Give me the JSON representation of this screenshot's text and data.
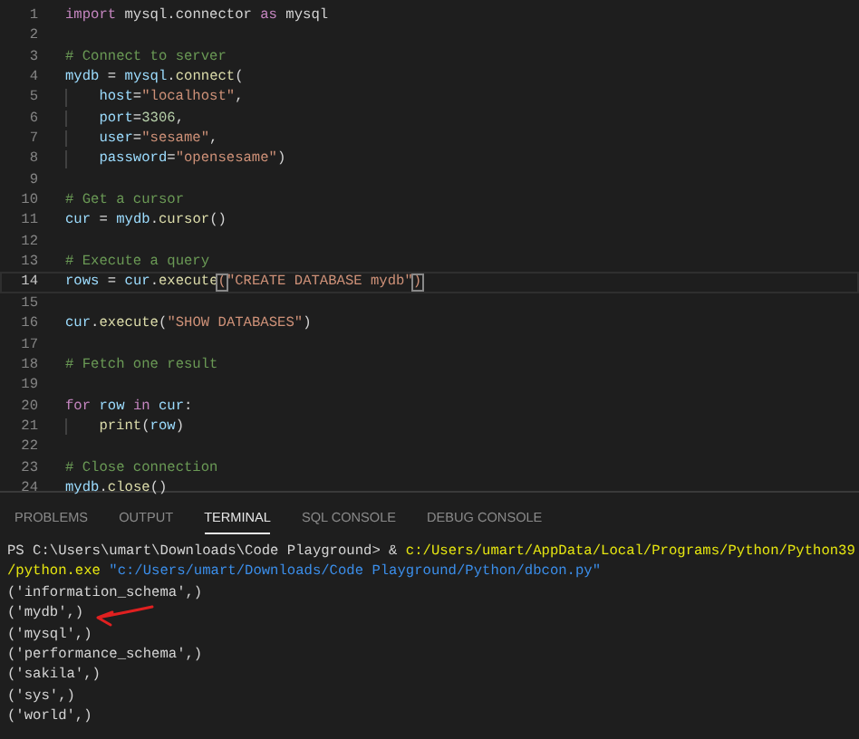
{
  "editor": {
    "lines": [
      {
        "number": "1",
        "current": false,
        "tokens": [
          {
            "kind": "keyword",
            "text": "import"
          },
          {
            "kind": "plain",
            "text": " mysql.connector "
          },
          {
            "kind": "keyword",
            "text": "as"
          },
          {
            "kind": "plain",
            "text": " mysql"
          }
        ]
      },
      {
        "number": "2",
        "current": false
      },
      {
        "number": "3",
        "current": false,
        "tokens": [
          {
            "kind": "comment",
            "text": "# Connect to server"
          }
        ]
      },
      {
        "number": "4",
        "current": false,
        "tokens": [
          {
            "kind": "var",
            "text": "mydb"
          },
          {
            "kind": "plain",
            "text": " = "
          },
          {
            "kind": "var",
            "text": "mysql"
          },
          {
            "kind": "plain",
            "text": "."
          },
          {
            "kind": "func",
            "text": "connect"
          },
          {
            "kind": "plain",
            "text": "("
          }
        ]
      },
      {
        "number": "5",
        "current": false,
        "indented": true,
        "tokens": [
          {
            "kind": "var",
            "text": "host"
          },
          {
            "kind": "plain",
            "text": "="
          },
          {
            "kind": "string",
            "text": "\"localhost\""
          },
          {
            "kind": "plain",
            "text": ","
          }
        ]
      },
      {
        "number": "6",
        "current": false,
        "indented": true,
        "tokens": [
          {
            "kind": "var",
            "text": "port"
          },
          {
            "kind": "plain",
            "text": "="
          },
          {
            "kind": "number",
            "text": "3306"
          },
          {
            "kind": "plain",
            "text": ","
          }
        ]
      },
      {
        "number": "7",
        "current": false,
        "indented": true,
        "tokens": [
          {
            "kind": "var",
            "text": "user"
          },
          {
            "kind": "plain",
            "text": "="
          },
          {
            "kind": "string",
            "text": "\"sesame\""
          },
          {
            "kind": "plain",
            "text": ","
          }
        ]
      },
      {
        "number": "8",
        "current": false,
        "indented": true,
        "tokens": [
          {
            "kind": "var",
            "text": "password"
          },
          {
            "kind": "plain",
            "text": "="
          },
          {
            "kind": "string",
            "text": "\"opensesame\""
          },
          {
            "kind": "plain",
            "text": ")"
          }
        ]
      },
      {
        "number": "9",
        "current": false
      },
      {
        "number": "10",
        "current": false,
        "tokens": [
          {
            "kind": "comment",
            "text": "# Get a cursor"
          }
        ]
      },
      {
        "number": "11",
        "current": false,
        "tokens": [
          {
            "kind": "var",
            "text": "cur"
          },
          {
            "kind": "plain",
            "text": " = "
          },
          {
            "kind": "var",
            "text": "mydb"
          },
          {
            "kind": "plain",
            "text": "."
          },
          {
            "kind": "func",
            "text": "cursor"
          },
          {
            "kind": "plain",
            "text": "()"
          }
        ]
      },
      {
        "number": "12",
        "current": false
      },
      {
        "number": "13",
        "current": false,
        "tokens": [
          {
            "kind": "comment",
            "text": "# Execute a query"
          }
        ]
      },
      {
        "number": "14",
        "current": true,
        "tokens": [
          {
            "kind": "var",
            "text": "rows"
          },
          {
            "kind": "plain",
            "text": " = "
          },
          {
            "kind": "var",
            "text": "cur"
          },
          {
            "kind": "plain",
            "text": "."
          },
          {
            "kind": "func",
            "text": "execute"
          },
          {
            "kind": "match",
            "text": "("
          },
          {
            "kind": "string",
            "text": "\"CREATE DATABASE mydb\""
          },
          {
            "kind": "match",
            "text": ")"
          }
        ]
      },
      {
        "number": "15",
        "current": false
      },
      {
        "number": "16",
        "current": false,
        "tokens": [
          {
            "kind": "var",
            "text": "cur"
          },
          {
            "kind": "plain",
            "text": "."
          },
          {
            "kind": "func",
            "text": "execute"
          },
          {
            "kind": "plain",
            "text": "("
          },
          {
            "kind": "string",
            "text": "\"SHOW DATABASES\""
          },
          {
            "kind": "plain",
            "text": ")"
          }
        ]
      },
      {
        "number": "17",
        "current": false
      },
      {
        "number": "18",
        "current": false,
        "tokens": [
          {
            "kind": "comment",
            "text": "# Fetch one result"
          }
        ]
      },
      {
        "number": "19",
        "current": false
      },
      {
        "number": "20",
        "current": false,
        "tokens": [
          {
            "kind": "keyword",
            "text": "for"
          },
          {
            "kind": "var",
            "text": " row "
          },
          {
            "kind": "keyword",
            "text": "in"
          },
          {
            "kind": "var",
            "text": " cur"
          },
          {
            "kind": "plain",
            "text": ":"
          }
        ]
      },
      {
        "number": "21",
        "current": false,
        "indented": true,
        "tokens": [
          {
            "kind": "func",
            "text": "print"
          },
          {
            "kind": "plain",
            "text": "("
          },
          {
            "kind": "var",
            "text": "row"
          },
          {
            "kind": "plain",
            "text": ")"
          }
        ]
      },
      {
        "number": "22",
        "current": false
      },
      {
        "number": "23",
        "current": false,
        "tokens": [
          {
            "kind": "comment",
            "text": "# Close connection"
          }
        ]
      },
      {
        "number": "24",
        "current": false,
        "tokens": [
          {
            "kind": "var",
            "text": "mydb"
          },
          {
            "kind": "plain",
            "text": "."
          },
          {
            "kind": "func",
            "text": "close"
          },
          {
            "kind": "plain",
            "text": "()"
          }
        ]
      }
    ]
  },
  "panel": {
    "tabs": [
      {
        "label": "PROBLEMS",
        "selected": false
      },
      {
        "label": "OUTPUT",
        "selected": false
      },
      {
        "label": "TERMINAL",
        "selected": true
      },
      {
        "label": "SQL CONSOLE",
        "selected": false
      },
      {
        "label": "DEBUG CONSOLE",
        "selected": false
      }
    ],
    "terminal": [
      {
        "marked": false,
        "segments": [
          {
            "kind": "plain",
            "text": "PS C:\\Users\\umart\\Downloads\\Code Playground> & "
          },
          {
            "kind": "command",
            "text": "c:/Users/umart/AppData/Local/Programs/Python/Python39"
          }
        ]
      },
      {
        "marked": false,
        "segments": [
          {
            "kind": "command",
            "text": "/python.exe"
          },
          {
            "kind": "argument",
            "text": " \"c:/Users/umart/Downloads/Code Playground/Python/dbcon.py\""
          }
        ]
      },
      {
        "marked": false,
        "segments": [
          {
            "kind": "plain",
            "text": "('information_schema',)"
          }
        ]
      },
      {
        "marked": true,
        "segments": [
          {
            "kind": "plain",
            "text": "('mydb',)"
          }
        ]
      },
      {
        "marked": false,
        "segments": [
          {
            "kind": "plain",
            "text": "('mysql',)"
          }
        ]
      },
      {
        "marked": false,
        "segments": [
          {
            "kind": "plain",
            "text": "('performance_schema',)"
          }
        ]
      },
      {
        "marked": false,
        "segments": [
          {
            "kind": "plain",
            "text": "('sakila',)"
          }
        ]
      },
      {
        "marked": false,
        "segments": [
          {
            "kind": "plain",
            "text": "('sys',)"
          }
        ]
      },
      {
        "marked": false,
        "segments": [
          {
            "kind": "plain",
            "text": "('world',)"
          }
        ]
      }
    ]
  }
}
